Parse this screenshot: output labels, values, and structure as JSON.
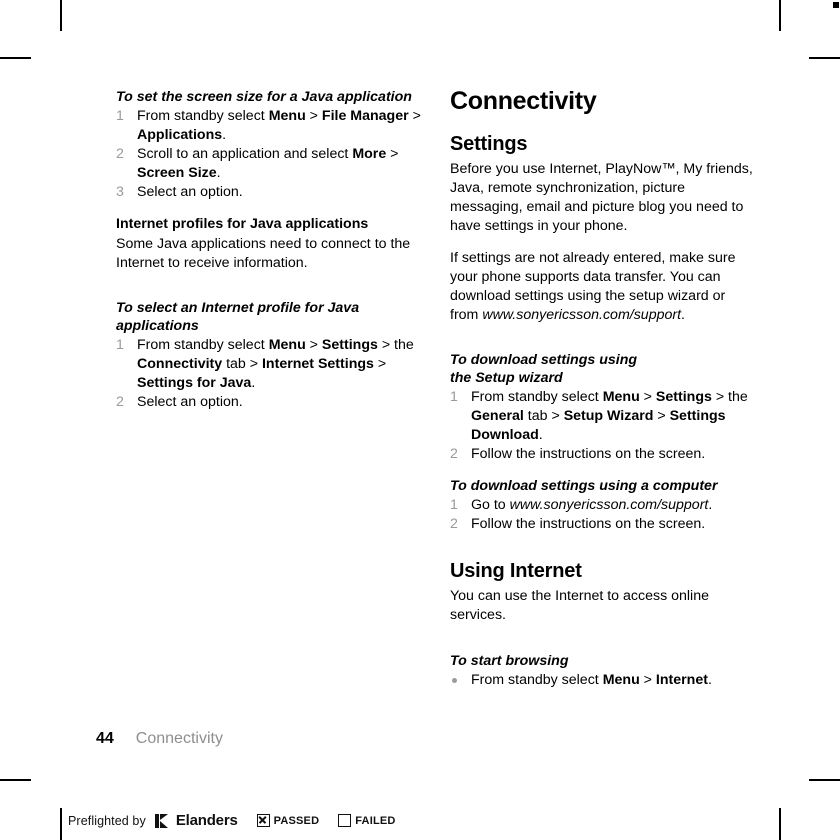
{
  "page": {
    "folio_number": "44",
    "folio_section": "Connectivity"
  },
  "left_column": {
    "task1": {
      "heading": [
        {
          "t": "To set the screen size for a Java application",
          "s": "bi"
        }
      ],
      "steps": [
        {
          "num": "1",
          "runs": [
            {
              "t": "From standby select ",
              "s": "n"
            },
            {
              "t": "Menu",
              "s": "b"
            },
            {
              "t": " > ",
              "s": "n"
            },
            {
              "t": "File Manager",
              "s": "b"
            },
            {
              "t": " > ",
              "s": "n"
            },
            {
              "t": "Applications",
              "s": "b"
            },
            {
              "t": ".",
              "s": "n"
            }
          ]
        },
        {
          "num": "2",
          "runs": [
            {
              "t": "Scroll to an application and select ",
              "s": "n"
            },
            {
              "t": "More",
              "s": "b"
            },
            {
              "t": " > ",
              "s": "n"
            },
            {
              "t": "Screen Size",
              "s": "b"
            },
            {
              "t": ".",
              "s": "n"
            }
          ]
        },
        {
          "num": "3",
          "runs": [
            {
              "t": "Select an option.",
              "s": "n"
            }
          ]
        }
      ]
    },
    "section_internet_profiles": {
      "heading": [
        {
          "t": "Internet profiles for Java applications",
          "s": "b"
        }
      ],
      "paragraph": [
        {
          "t": "Some Java applications need to connect to the Internet to receive information.",
          "s": "n"
        }
      ]
    },
    "task2": {
      "heading": [
        {
          "t": "To select an Internet profile for Java applications",
          "s": "bi"
        }
      ],
      "steps": [
        {
          "num": "1",
          "runs": [
            {
              "t": "From standby select ",
              "s": "n"
            },
            {
              "t": "Menu",
              "s": "b"
            },
            {
              "t": " > ",
              "s": "n"
            },
            {
              "t": "Settings",
              "s": "b"
            },
            {
              "t": " > the ",
              "s": "n"
            },
            {
              "t": "Connectivity",
              "s": "b"
            },
            {
              "t": " tab > ",
              "s": "n"
            },
            {
              "t": "Internet Settings",
              "s": "b"
            },
            {
              "t": " > ",
              "s": "n"
            },
            {
              "t": "Settings for Java",
              "s": "b"
            },
            {
              "t": ".",
              "s": "n"
            }
          ]
        },
        {
          "num": "2",
          "runs": [
            {
              "t": "Select an option.",
              "s": "n"
            }
          ]
        }
      ]
    }
  },
  "right_column": {
    "chapter_title": "Connectivity",
    "section_settings": {
      "heading": "Settings",
      "paragraph1": [
        {
          "t": "Before you use Internet, PlayNow™, My friends, Java, remote synchronization, picture messaging, email and picture blog you need to have settings in your phone.",
          "s": "n"
        }
      ],
      "paragraph2": [
        {
          "t": "If settings are not already entered, make sure your phone supports data transfer. You can download settings using the setup wizard or from ",
          "s": "n"
        },
        {
          "t": "www.sonyericsson.com/support",
          "s": "i"
        },
        {
          "t": ".",
          "s": "n"
        }
      ]
    },
    "task_setup_wizard": {
      "heading": [
        {
          "t": "To download settings using",
          "s": "bi"
        },
        {
          "t": "\n",
          "s": "br"
        },
        {
          "t": "the Setup wizard",
          "s": "bi"
        }
      ],
      "steps": [
        {
          "num": "1",
          "runs": [
            {
              "t": "From standby select ",
              "s": "n"
            },
            {
              "t": "Menu",
              "s": "b"
            },
            {
              "t": " > ",
              "s": "n"
            },
            {
              "t": "Settings",
              "s": "b"
            },
            {
              "t": " > the ",
              "s": "n"
            },
            {
              "t": "General",
              "s": "b"
            },
            {
              "t": " tab > ",
              "s": "n"
            },
            {
              "t": "Setup Wizard",
              "s": "b"
            },
            {
              "t": " > ",
              "s": "n"
            },
            {
              "t": "Settings Download",
              "s": "b"
            },
            {
              "t": ".",
              "s": "n"
            }
          ]
        },
        {
          "num": "2",
          "runs": [
            {
              "t": "Follow the instructions on the screen.",
              "s": "n"
            }
          ]
        }
      ]
    },
    "task_computer": {
      "heading": [
        {
          "t": "To download settings using a computer",
          "s": "bi"
        }
      ],
      "steps": [
        {
          "num": "1",
          "runs": [
            {
              "t": "Go to ",
              "s": "n"
            },
            {
              "t": "www.sonyericsson.com/support",
              "s": "i"
            },
            {
              "t": ".",
              "s": "n"
            }
          ]
        },
        {
          "num": "2",
          "runs": [
            {
              "t": "Follow the instructions on the screen.",
              "s": "n"
            }
          ]
        }
      ]
    },
    "section_using_internet": {
      "heading": "Using Internet",
      "paragraph": [
        {
          "t": "You can use the Internet to access online services.",
          "s": "n"
        }
      ]
    },
    "task_browsing": {
      "heading": [
        {
          "t": "To start browsing",
          "s": "bi"
        }
      ],
      "bullets": [
        {
          "runs": [
            {
              "t": "From standby select ",
              "s": "n"
            },
            {
              "t": "Menu",
              "s": "b"
            },
            {
              "t": " > ",
              "s": "n"
            },
            {
              "t": "Internet",
              "s": "b"
            },
            {
              "t": ".",
              "s": "n"
            }
          ]
        }
      ]
    }
  },
  "preflight": {
    "prefix": "Preflighted by",
    "brand": "Elanders",
    "passed_label": "PASSED",
    "failed_label": "FAILED",
    "passed_checked": true,
    "failed_checked": false
  }
}
